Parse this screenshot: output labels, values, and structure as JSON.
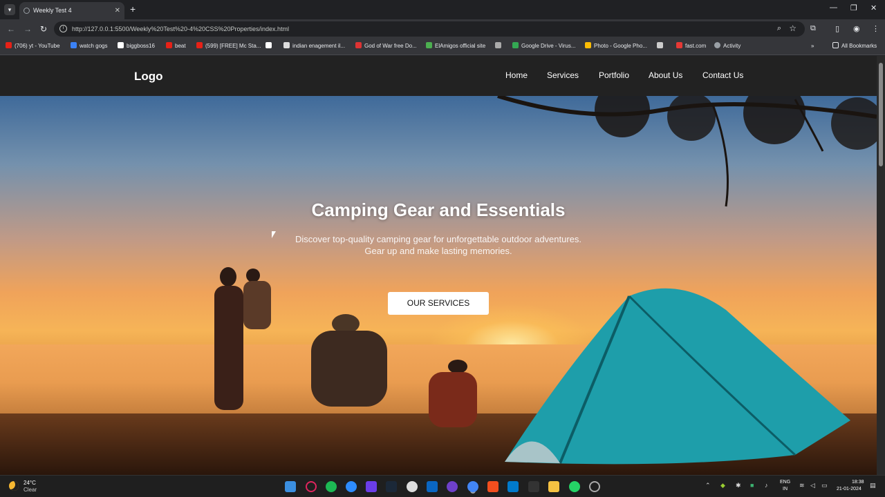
{
  "browser": {
    "tab_title": "Weekly Test 4",
    "url": "http://127.0.0.1:5500/Weekly%20Test%20-4%20CSS%20Properties/index.html",
    "bookmarks": [
      "(706) yt - YouTube",
      "watch gogs",
      "biggboss16",
      "beat",
      "(599) [FREE] Mc Sta...",
      "",
      "indian enagement il...",
      "God of War free Do...",
      "ElAmigos official site",
      "",
      "Google Drive - Virus...",
      "Photo - Google Pho...",
      "",
      "fast.com",
      "Activity"
    ],
    "all_bookmarks": "All Bookmarks"
  },
  "site": {
    "logo": "Logo",
    "nav": [
      "Home",
      "Services",
      "Portfolio",
      "About Us",
      "Contact Us"
    ],
    "hero_title": "Camping Gear and Essentials",
    "hero_sub_line1": "Discover top-quality camping gear for unforgettable outdoor adventures.",
    "hero_sub_line2": "Gear up and make lasting memories.",
    "cta": "OUR SERVICES"
  },
  "taskbar": {
    "temp": "24°C",
    "condition": "Clear",
    "lang1": "ENG",
    "lang2": "IN",
    "time": "18:38",
    "date": "21-01-2024"
  }
}
